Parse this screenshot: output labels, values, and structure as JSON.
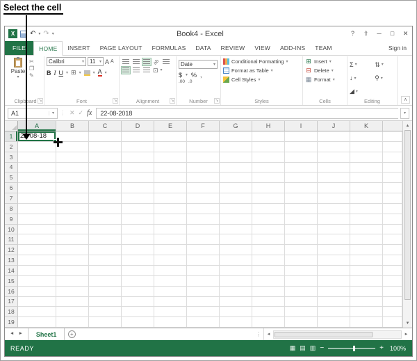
{
  "annotation": {
    "label": "Select the cell"
  },
  "window": {
    "title": "Book4 - Excel"
  },
  "tabs": {
    "file": "FILE",
    "items": [
      {
        "label": "HOME",
        "active": true
      },
      {
        "label": "INSERT"
      },
      {
        "label": "PAGE LAYOUT"
      },
      {
        "label": "FORMULAS"
      },
      {
        "label": "DATA"
      },
      {
        "label": "REVIEW"
      },
      {
        "label": "VIEW"
      },
      {
        "label": "ADD-INS"
      },
      {
        "label": "TEAM"
      }
    ],
    "sign_in": "Sign in"
  },
  "ribbon": {
    "clipboard": {
      "paste": "Paste",
      "group": "Clipboard"
    },
    "font": {
      "name": "Calibri",
      "size": "11",
      "bold": "B",
      "italic": "I",
      "underline": "U",
      "group": "Font"
    },
    "alignment": {
      "group": "Alignment"
    },
    "number": {
      "format": "Date",
      "currency": "$",
      "percent": "%",
      "comma": ",",
      "group": "Number"
    },
    "styles": {
      "items": [
        "Conditional Formatting",
        "Format as Table",
        "Cell Styles"
      ],
      "group": "Styles"
    },
    "cells": {
      "items": [
        "Insert",
        "Delete",
        "Format"
      ],
      "group": "Cells"
    },
    "editing": {
      "autosum": "Σ",
      "group": "Editing"
    }
  },
  "formula_bar": {
    "name_box": "A1",
    "fx": "fx",
    "value": "22-08-2018"
  },
  "grid": {
    "columns": [
      "A",
      "B",
      "C",
      "D",
      "E",
      "F",
      "G",
      "H",
      "I",
      "J",
      "K"
    ],
    "row_count": 19,
    "active_cell": {
      "ref": "A1",
      "value": "22-08-18"
    }
  },
  "sheets": {
    "active": "Sheet1"
  },
  "status_bar": {
    "mode": "READY",
    "zoom_minus": "−",
    "zoom_plus": "+",
    "zoom": "100%"
  },
  "colors": {
    "excel_green": "#217346",
    "selection_border": "#217346",
    "gridline": "#dcdcdc"
  }
}
